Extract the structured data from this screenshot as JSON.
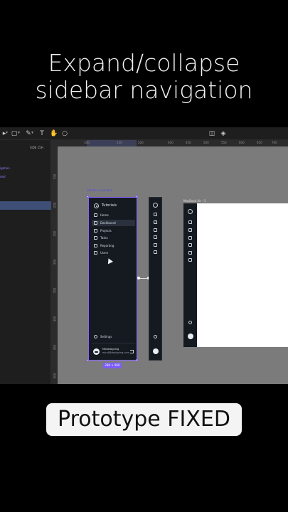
{
  "title": {
    "line1": "Expand/collapse",
    "line2": "sidebar navigation"
  },
  "toolbar": {
    "icons": [
      "move-tool-icon",
      "frame-tool-icon",
      "pen-tool-icon",
      "text-tool-icon",
      "hand-tool-icon",
      "comment-tool-icon",
      "component-icon",
      "prototype-icon"
    ]
  },
  "left_panel": {
    "tab_label": "SIDE 15H",
    "items": [
      "igation",
      "ded"
    ]
  },
  "ruler": {
    "top_ticks": [
      "100",
      "150",
      "200",
      "400",
      "450",
      "500",
      "550",
      "600",
      "650",
      "700"
    ],
    "left_ticks": [
      "150",
      "200",
      "250",
      "300",
      "350",
      "400",
      "450",
      "500"
    ]
  },
  "canvas": {
    "frame_label": "Sidebar expanded",
    "macbook_label": "MacBook Air - 1",
    "dimensions_badge": "280 × 960"
  },
  "sidebar": {
    "title": "Tutorials",
    "nav": [
      {
        "label": "Home",
        "icon": "home-icon",
        "active": false
      },
      {
        "label": "Dashboard",
        "icon": "dashboard-icon",
        "active": true
      },
      {
        "label": "Projects",
        "icon": "projects-icon",
        "active": false
      },
      {
        "label": "Tasks",
        "icon": "tasks-icon",
        "active": false
      },
      {
        "label": "Reporting",
        "icon": "flag-icon",
        "active": false
      },
      {
        "label": "Users",
        "icon": "users-icon",
        "active": false
      }
    ],
    "settings": "Settings",
    "user_name": "Mindesigning",
    "user_email": "mind@designing.com"
  },
  "overlay": {
    "text": "Prototype FIXED"
  },
  "colors": {
    "accent": "#8b63ff",
    "sidebar_bg": "#151a21",
    "canvas_bg": "#7b7b7b"
  }
}
